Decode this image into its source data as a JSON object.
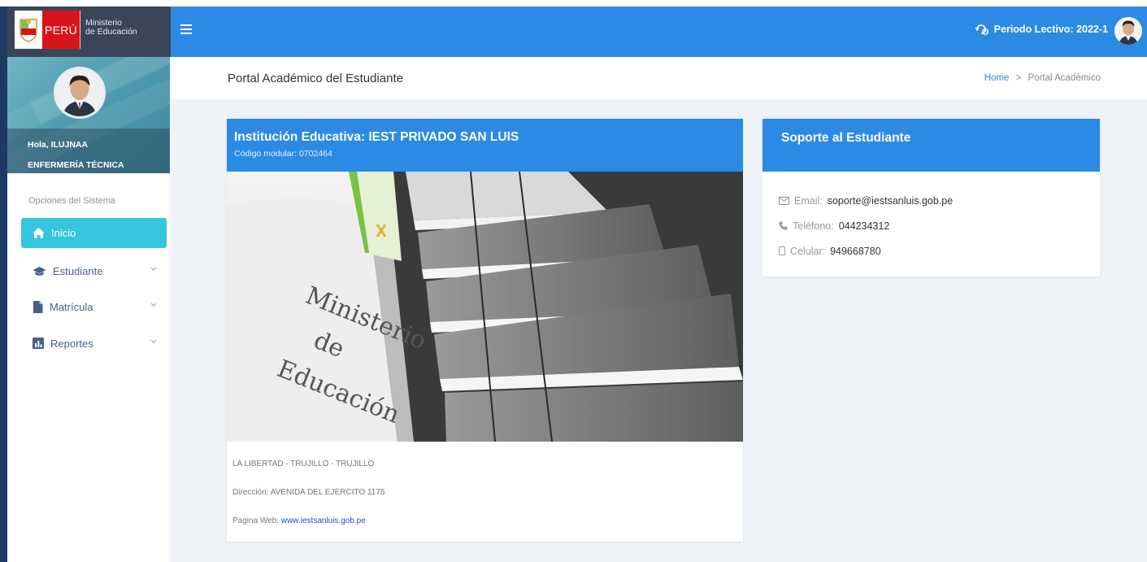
{
  "brand": {
    "country": "PERÚ",
    "ministry_line1": "Ministerio",
    "ministry_line2": "de Educación"
  },
  "topbar": {
    "periodo_label": "Periodo Lectivo: 2022-1"
  },
  "user": {
    "greeting": "Hola, ILUJNAA",
    "program": "ENFERMERÍA TÉCNICA"
  },
  "sidebar": {
    "section_title": "Opciones del Sistema",
    "items": [
      {
        "label": "Inicio",
        "icon": "home-icon"
      },
      {
        "label": "Estudiante",
        "icon": "graduation-cap-icon"
      },
      {
        "label": "Matrícula",
        "icon": "file-icon"
      },
      {
        "label": "Reportes",
        "icon": "bar-chart-icon"
      }
    ]
  },
  "page": {
    "title": "Portal Académico del Estudiante"
  },
  "breadcrumb": {
    "home": "Home",
    "separator": ">",
    "current": "Portal Académico"
  },
  "institution": {
    "title": "Institución Educativa: IEST PRIVADO SAN LUIS",
    "code": "Código modular: 0702464",
    "image_text_1": "Ministerio",
    "image_text_2": "de",
    "image_text_3": "Educación",
    "location": "LA LIBERTAD - TRUJILLO - TRUJILLO",
    "address": "Dirección: AVENIDA DEL EJERCITO 1175",
    "web_label": "Pagina Web:",
    "web_url": "www.iestsanluis.gob.pe"
  },
  "support": {
    "title": "Soporte al Estudiante",
    "email_label": "Email:",
    "email_value": "soporte@iestsanluis.gob.pe",
    "phone_label": "Teléfono:",
    "phone_value": "044234312",
    "cell_label": "Celular:",
    "cell_value": "949668780"
  },
  "colors": {
    "primary": "#2b8ae4",
    "accent": "#35c5dd",
    "sidebar_link": "#4a5e8a",
    "flag_red": "#d7141a"
  }
}
